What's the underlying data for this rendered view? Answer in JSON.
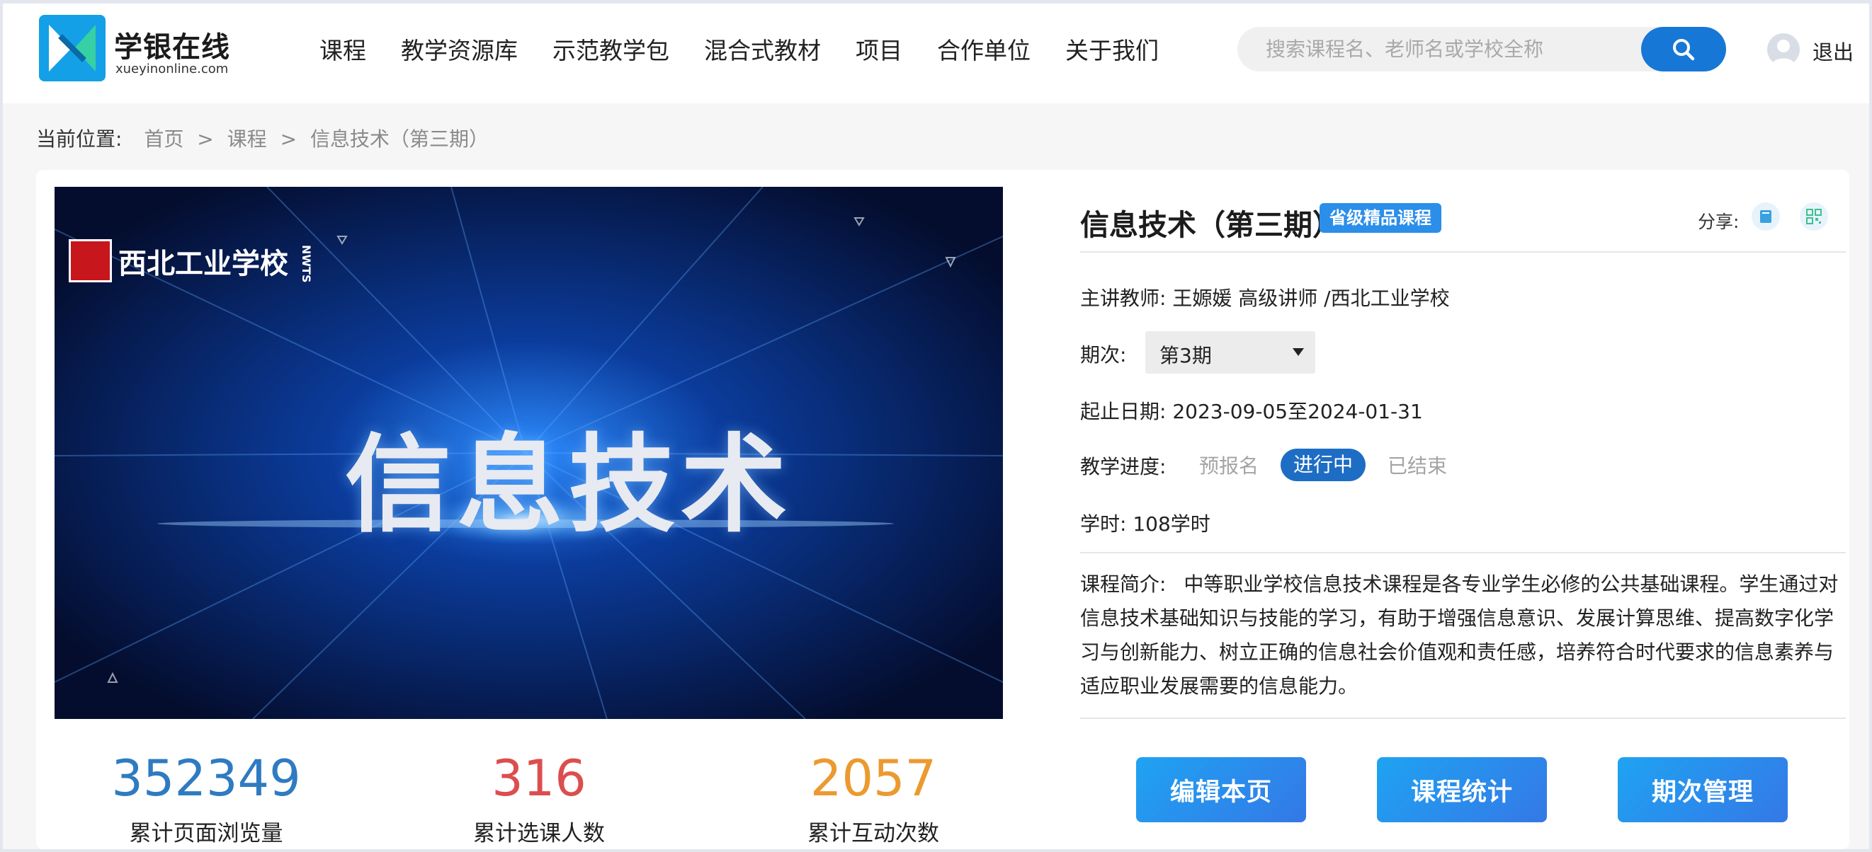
{
  "header": {
    "logo_title": "学银在线",
    "logo_domain": "xueyinonline.com",
    "nav": [
      "课程",
      "教学资源库",
      "示范教学包",
      "混合式教材",
      "项目",
      "合作单位",
      "关于我们"
    ],
    "search_placeholder": "搜索课程名、老师名或学校全称",
    "logout_label": "退出"
  },
  "breadcrumb": {
    "prefix": "当前位置:",
    "items": [
      "首页",
      "课程",
      "信息技术（第三期）"
    ],
    "separator": ">"
  },
  "cover": {
    "school_name": "西北工业学校",
    "school_abbr": "NWTS",
    "headline": "信息技术"
  },
  "course": {
    "title": "信息技术（第三期）",
    "badge": "省级精品课程",
    "share_label": "分享:",
    "teacher_label": "主讲教师:",
    "teacher_value": "王嫄媛 高级讲师 /西北工业学校",
    "term_label": "期次:",
    "term_value": "第3期",
    "dates_label": "起止日期:",
    "dates_value": "2023-09-05至2024-01-31",
    "progress_label": "教学进度:",
    "progress_steps": [
      "预报名",
      "进行中",
      "已结束"
    ],
    "progress_active": "进行中",
    "hours_label": "学时:",
    "hours_value": "108学时",
    "intro_label": "课程简介:",
    "intro_text": "中等职业学校信息技术课程是各专业学生必修的公共基础课程。学生通过对信息技术基础知识与技能的学习，有助于增强信息意识、发展计算思维、提高数字化学习与创新能力、树立正确的信息社会价值观和责任感，培养符合时代要求的信息素养与适应职业发展需要的信息能力。"
  },
  "actions": [
    "编辑本页",
    "课程统计",
    "期次管理"
  ],
  "stats": [
    {
      "value": "352349",
      "label": "累计页面浏览量",
      "color": "#2f7bc1"
    },
    {
      "value": "316",
      "label": "累计选课人数",
      "color": "#dc4e4e"
    },
    {
      "value": "2057",
      "label": "累计互动次数",
      "color": "#eb9a2f"
    }
  ],
  "colors": {
    "primary": "#1677d6",
    "badge": "#2b8ee9",
    "active_step": "#1e6dc5"
  }
}
